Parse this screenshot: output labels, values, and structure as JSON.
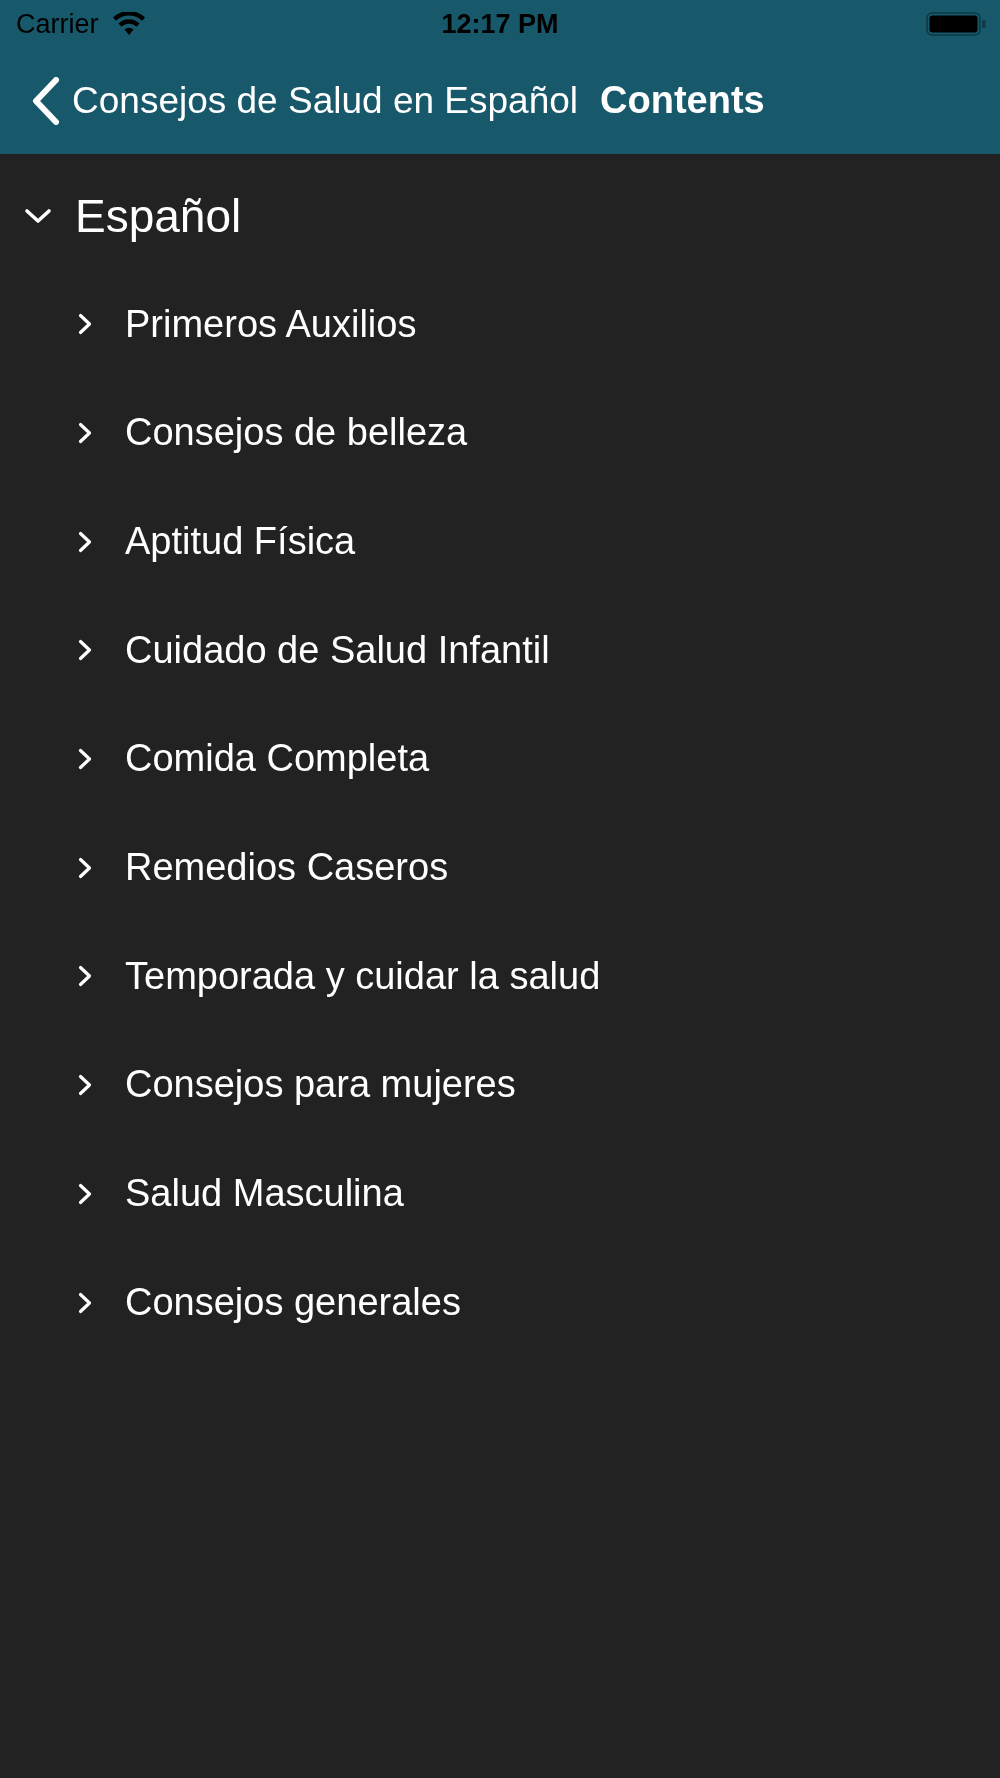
{
  "status_bar": {
    "carrier": "Carrier",
    "time": "12:17 PM"
  },
  "nav_bar": {
    "back_label": "Consejos de Salud en Español",
    "title": "Contents"
  },
  "tree": [
    {
      "label": "Español",
      "expanded": true,
      "children": [
        {
          "label": "Primeros Auxilios",
          "expanded": false
        },
        {
          "label": "Consejos de belleza",
          "expanded": false
        },
        {
          "label": "Aptitud Física",
          "expanded": false
        },
        {
          "label": "Cuidado de Salud Infantil",
          "expanded": false
        },
        {
          "label": "Comida Completa",
          "expanded": false
        },
        {
          "label": "Remedios Caseros",
          "expanded": false
        },
        {
          "label": "Temporada y cuidar la salud",
          "expanded": false
        },
        {
          "label": "Consejos para mujeres",
          "expanded": false
        },
        {
          "label": "Salud Masculina",
          "expanded": false
        },
        {
          "label": "Consejos generales",
          "expanded": false
        }
      ]
    }
  ]
}
